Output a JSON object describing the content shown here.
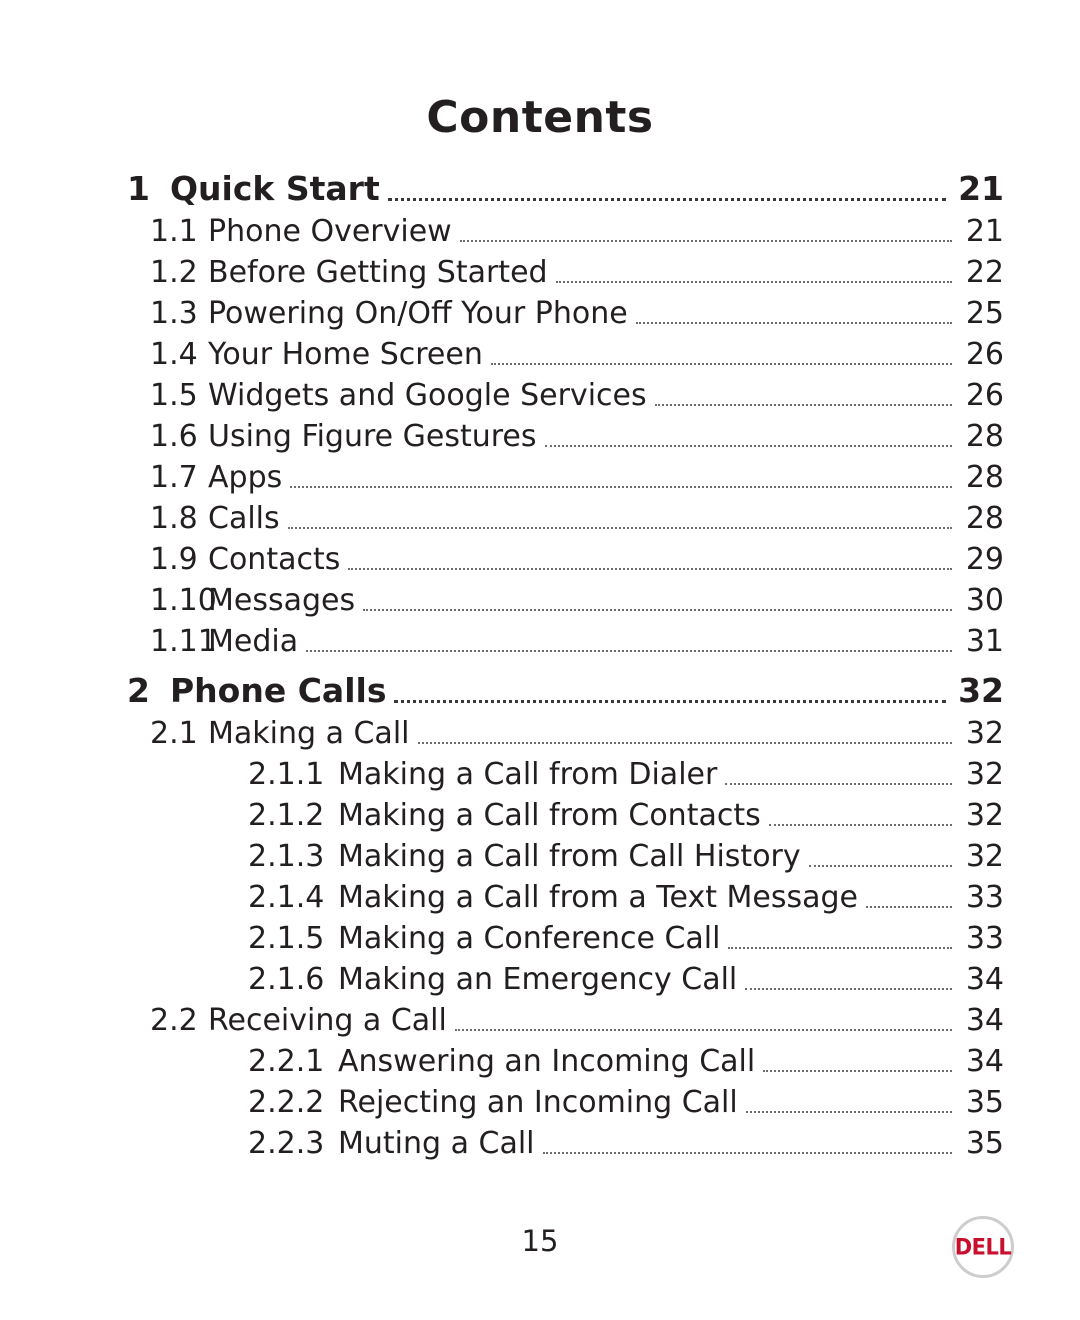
{
  "document": {
    "title": "Contents",
    "page_number": "15",
    "brand": "DELL",
    "brand_color": "#c8102e"
  },
  "toc": [
    {
      "level": 1,
      "num": "1",
      "label": "Quick Start",
      "page": "21"
    },
    {
      "level": 2,
      "num": "1.1",
      "label": "Phone Overview",
      "page": "21"
    },
    {
      "level": 2,
      "num": "1.2",
      "label": "Before Getting Started",
      "page": "22"
    },
    {
      "level": 2,
      "num": "1.3",
      "label": "Powering On/Off Your Phone",
      "page": "25"
    },
    {
      "level": 2,
      "num": "1.4",
      "label": "Your Home Screen",
      "page": "26"
    },
    {
      "level": 2,
      "num": "1.5",
      "label": "Widgets and Google Services",
      "page": "26"
    },
    {
      "level": 2,
      "num": "1.6",
      "label": "Using Figure Gestures",
      "page": "28"
    },
    {
      "level": 2,
      "num": "1.7",
      "label": "Apps",
      "page": "28"
    },
    {
      "level": 2,
      "num": "1.8",
      "label": "Calls",
      "page": "28"
    },
    {
      "level": 2,
      "num": "1.9",
      "label": "Contacts",
      "page": "29"
    },
    {
      "level": 2,
      "num": "1.10",
      "label": "Messages",
      "page": "30"
    },
    {
      "level": 2,
      "num": "1.11",
      "label": "Media",
      "page": "31"
    },
    {
      "level": 1,
      "num": "2",
      "label": "Phone Calls",
      "page": "32"
    },
    {
      "level": 2,
      "num": "2.1",
      "label": "Making a Call",
      "page": "32"
    },
    {
      "level": 3,
      "num": "2.1.1",
      "label": "Making a Call from Dialer",
      "page": "32"
    },
    {
      "level": 3,
      "num": "2.1.2",
      "label": "Making a Call from Contacts",
      "page": "32"
    },
    {
      "level": 3,
      "num": "2.1.3",
      "label": "Making a Call from Call History",
      "page": "32"
    },
    {
      "level": 3,
      "num": "2.1.4",
      "label": "Making a Call from a Text Message",
      "page": "33"
    },
    {
      "level": 3,
      "num": "2.1.5",
      "label": "Making a Conference Call",
      "page": "33"
    },
    {
      "level": 3,
      "num": "2.1.6",
      "label": "Making an Emergency Call",
      "page": "34"
    },
    {
      "level": 2,
      "num": "2.2",
      "label": "Receiving a Call",
      "page": "34"
    },
    {
      "level": 3,
      "num": "2.2.1",
      "label": "Answering an Incoming Call",
      "page": "34"
    },
    {
      "level": 3,
      "num": "2.2.2",
      "label": "Rejecting an Incoming Call",
      "page": "35"
    },
    {
      "level": 3,
      "num": "2.2.3",
      "label": "Muting a Call",
      "page": "35"
    }
  ]
}
